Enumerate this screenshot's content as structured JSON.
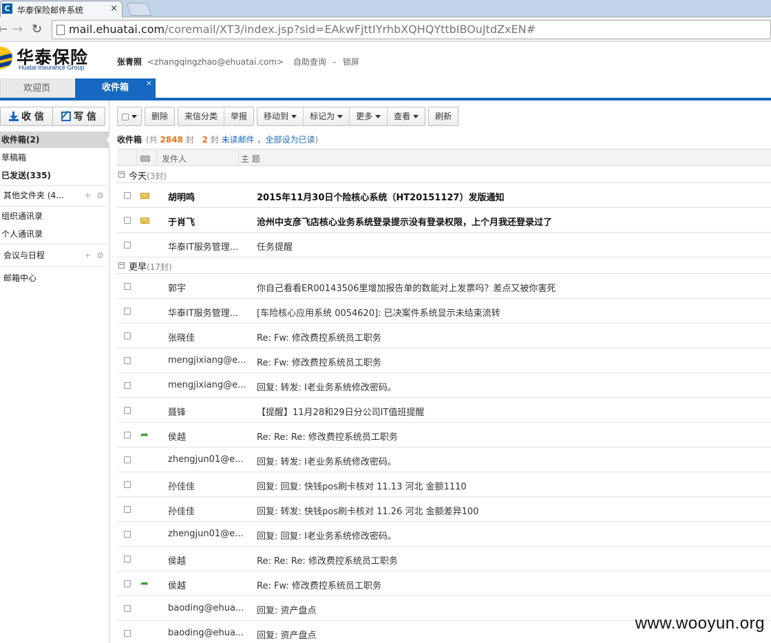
{
  "browser": {
    "tab_title": "华泰保险邮件系统",
    "tab_favicon": "C",
    "url_host": "mail.ehuatai.com",
    "url_path": "/coremail/XT3/index.jsp?sid=EAkwFjttIYrhbXQHQYttbIBOuJtdZxEN#"
  },
  "brand": {
    "logo_cn": "华泰保险",
    "logo_en": "Huatai Insurance Group",
    "primary_color": "#1668c0"
  },
  "user": {
    "name": "张青照",
    "email": "<zhangqingzhao@ehuatai.com>",
    "link_query": "自助查询",
    "separator": "-",
    "link_lock": "锁屏"
  },
  "app_tabs": [
    {
      "label": "欢迎页"
    },
    {
      "label": "收件箱",
      "close": "×"
    }
  ],
  "sidebar": {
    "receive": "收 信",
    "compose": "写 信",
    "folders": [
      {
        "label": "收件箱(2)"
      },
      {
        "label": "草稿箱"
      },
      {
        "label": "已发送(335)"
      },
      {
        "label": "其他文件夹 (4..."
      },
      {
        "label": "组织通讯录"
      },
      {
        "label": "个人通讯录"
      },
      {
        "label": "会议与日程"
      },
      {
        "label": "邮箱中心"
      }
    ]
  },
  "toolbar": {
    "delete": "删除",
    "classify": "来信分类",
    "report": "举报",
    "move_to": "移动到",
    "mark_as": "标记为",
    "more": "更多",
    "view": "查看",
    "refresh": "刷新"
  },
  "summary": {
    "folder": "收件箱",
    "total_prefix": "(共",
    "total": "2848",
    "total_unit": "封",
    "unread": "2",
    "unread_unit": "封",
    "unread_label": "未读邮件",
    "mark_all_prefix": "，",
    "mark_all": "全部设为已读",
    "close_paren": ")"
  },
  "columns": {
    "sender": "发件人",
    "subject": "主 题"
  },
  "groups": {
    "today": {
      "label": "今天",
      "count": "(3封)"
    },
    "earlier": {
      "label": "更早",
      "count": "(17封)"
    }
  },
  "emails_today": [
    {
      "sender": "胡明鸣",
      "subject": "2015年11月30日个险核心系统（HT20151127）发版通知",
      "status": "unread"
    },
    {
      "sender": "于肖飞",
      "subject": "沧州中支彦飞店核心业务系统登录提示没有登录权限，上个月我还登录过了",
      "status": "unread"
    },
    {
      "sender": "华泰IT服务管理...",
      "subject": "任务提醒",
      "status": "read"
    }
  ],
  "emails_earlier": [
    {
      "sender": "郭宇",
      "subject": "你自己看看ER00143506里增加报告单的数能对上发票吗？差点又被你害死",
      "status": "read"
    },
    {
      "sender": "华泰IT服务管理...",
      "subject": "[车险核心应用系统 0054620]: 已决案件系统显示未结束流转",
      "status": "read"
    },
    {
      "sender": "张晓佳",
      "subject": "Re: Fw: 修改费控系统员工职务",
      "status": "read"
    },
    {
      "sender": "mengjixiang@e...",
      "subject": "Re: Fw: 修改费控系统员工职务",
      "status": "read"
    },
    {
      "sender": "mengjixiang@e...",
      "subject": "回复: 转发: I老业务系统修改密码。",
      "status": "read"
    },
    {
      "sender": "聂锋",
      "subject": "【提醒】11月28和29日分公司IT值班提醒",
      "status": "read"
    },
    {
      "sender": "侯越",
      "subject": "Re: Re: Re: 修改费控系统员工职务",
      "status": "replied"
    },
    {
      "sender": "zhengjun01@e...",
      "subject": "回复: 转发: I老业务系统修改密码。",
      "status": "read"
    },
    {
      "sender": "孙佳佳",
      "subject": "回复: 回复: 快钱pos刷卡核对 11.13 河北 金额1110",
      "status": "read"
    },
    {
      "sender": "孙佳佳",
      "subject": "回复: 转发: 快钱pos刷卡核对 11.26 河北 金额差异100",
      "status": "read"
    },
    {
      "sender": "zhengjun01@e...",
      "subject": "回复: 回复: I老业务系统修改密码。",
      "status": "read"
    },
    {
      "sender": "侯越",
      "subject": "Re: Re: Re: 修改费控系统员工职务",
      "status": "read"
    },
    {
      "sender": "侯越",
      "subject": "Re: Fw: 修改费控系统员工职务",
      "status": "replied"
    },
    {
      "sender": "baoding@ehua...",
      "subject": "回复: 资产盘点",
      "status": "read"
    },
    {
      "sender": "baoding@ehua...",
      "subject": "回复: 资产盘点",
      "status": "read"
    }
  ],
  "watermark": "www.wooyun.org"
}
